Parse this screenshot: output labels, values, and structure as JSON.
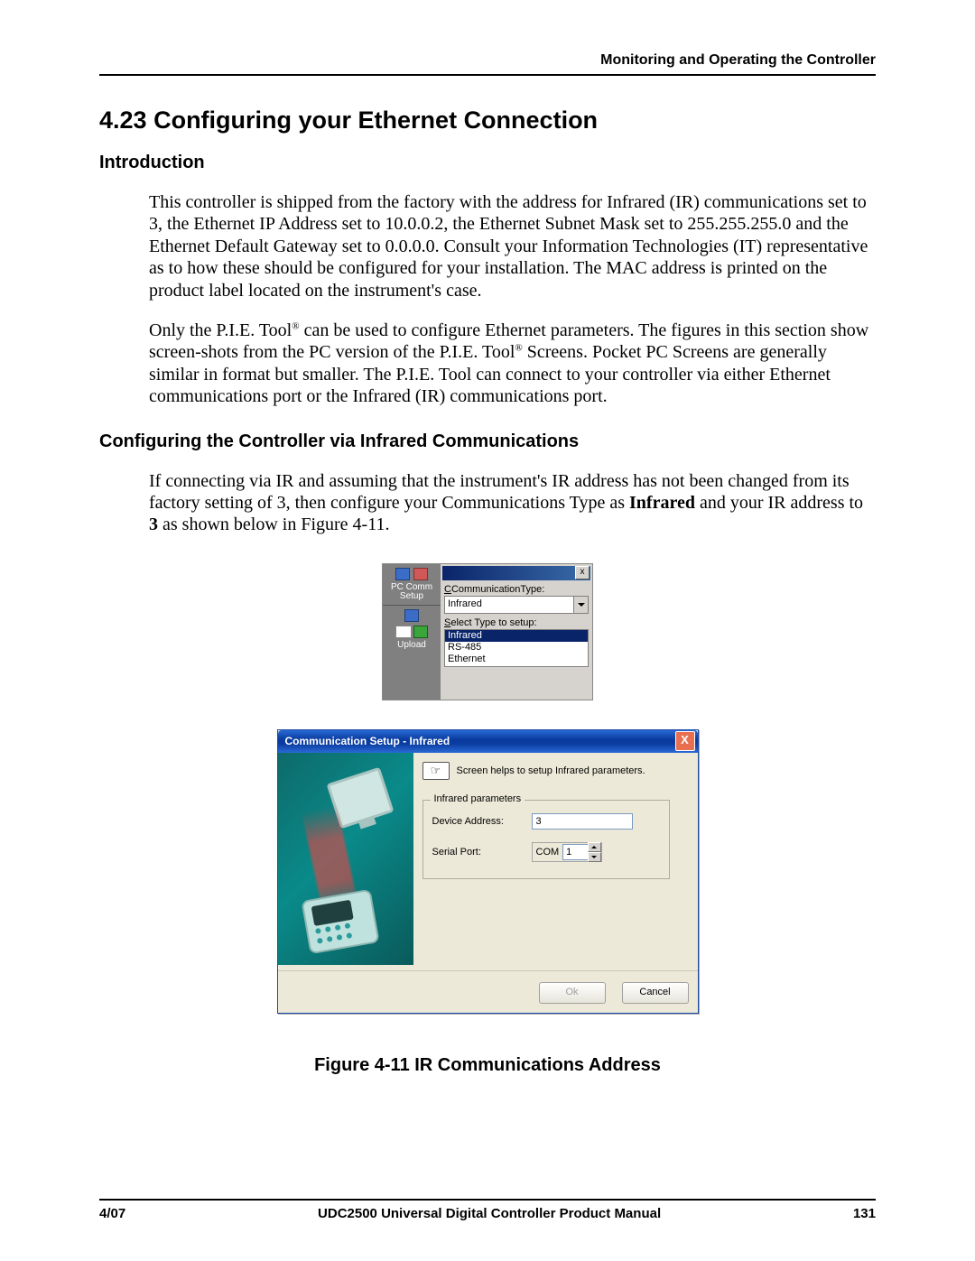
{
  "page": {
    "running_head": "Monitoring and Operating the Controller",
    "section_number": "4.23",
    "section_title": "Configuring your Ethernet Connection",
    "intro_heading": "Introduction",
    "intro_p1": "This controller is shipped from the factory with the address for Infrared (IR) communications set to 3, the Ethernet IP Address set to 10.0.0.2, the Ethernet Subnet Mask set to 255.255.255.0 and the Ethernet Default Gateway set to 0.0.0.0. Consult your Information Technologies (IT) representative as to how these should be configured for your installation. The MAC address is printed on the product label located on the instrument's case.",
    "intro_p2_a": "Only the P.I.E. Tool",
    "intro_p2_b": " can be used to configure Ethernet parameters. The figures in this section show screen-shots from the PC version of the P.I.E. Tool",
    "intro_p2_c": " Screens. Pocket PC Screens are generally similar in format but smaller. The P.I.E. Tool can connect to your controller via either Ethernet communications port or the Infrared (IR) communications port.",
    "reg_mark": "®",
    "ir_heading": "Configuring the Controller via Infrared Communications",
    "ir_p1_a": "If connecting via IR and assuming that the instrument's IR address has not been changed from its factory setting of 3, then configure your Communications Type as ",
    "ir_p1_bold1": "Infrared",
    "ir_p1_b": " and your IR address to ",
    "ir_p1_bold2": "3",
    "ir_p1_c": " as shown below in Figure 4-11.",
    "figure_caption": "Figure 4-11  IR Communications Address"
  },
  "mini": {
    "left_label1": "PC Comm\nSetup",
    "left_label2": "Upload",
    "close_x": "x",
    "label_commtype_pre": "CommunicationType:",
    "label_commtype_ul": "C",
    "combo_value": "Infrared",
    "label_select_pre": "elect Type to setup:",
    "label_select_ul": "S",
    "list": {
      "item0": "Infrared",
      "item1": "RS-485",
      "item2": "Ethernet"
    }
  },
  "dialog": {
    "title": "Communication Setup - Infrared",
    "close_x": "X",
    "helper_glyph": "☞",
    "helper_text": "Screen helps to setup Infrared parameters.",
    "fieldset_legend": "Infrared parameters",
    "label_device_addr": "Device Address:",
    "value_device_addr": "3",
    "label_serial_port": "Serial Port:",
    "com_prefix": "COM",
    "com_value": "1",
    "btn_ok": "Ok",
    "btn_cancel": "Cancel"
  },
  "footer": {
    "left": "4/07",
    "center": "UDC2500 Universal Digital Controller Product Manual",
    "right": "131"
  }
}
